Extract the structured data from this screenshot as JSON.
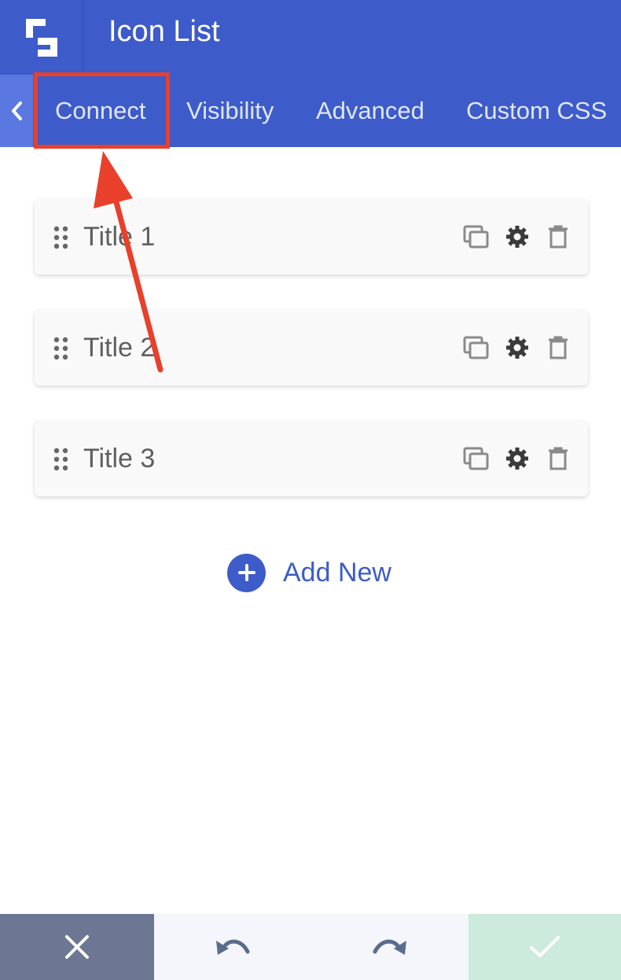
{
  "header": {
    "title": "Icon List",
    "logo_icon": "beaver-builder-logo-icon"
  },
  "tabs": {
    "back_icon": "chevron-left-icon",
    "items": [
      {
        "label": "Connect",
        "highlighted": true
      },
      {
        "label": "Visibility"
      },
      {
        "label": "Advanced"
      },
      {
        "label": "Custom CSS"
      }
    ]
  },
  "list": {
    "items": [
      {
        "title": "Title 1"
      },
      {
        "title": "Title 2"
      },
      {
        "title": "Title 3"
      }
    ],
    "item_actions": [
      "duplicate-icon",
      "settings-gear-icon",
      "trash-icon"
    ]
  },
  "add_new": {
    "label": "Add New"
  },
  "footer": {
    "buttons": [
      "close-icon",
      "undo-icon",
      "redo-icon",
      "checkmark-icon"
    ]
  },
  "colors": {
    "header_bg": "#3d5bc9",
    "tab_text": "#dfe6fb",
    "highlight": "#e8402b",
    "accent": "#3d5bc9",
    "footer_cancel": "#6c7793",
    "footer_save": "#cdebdc"
  }
}
